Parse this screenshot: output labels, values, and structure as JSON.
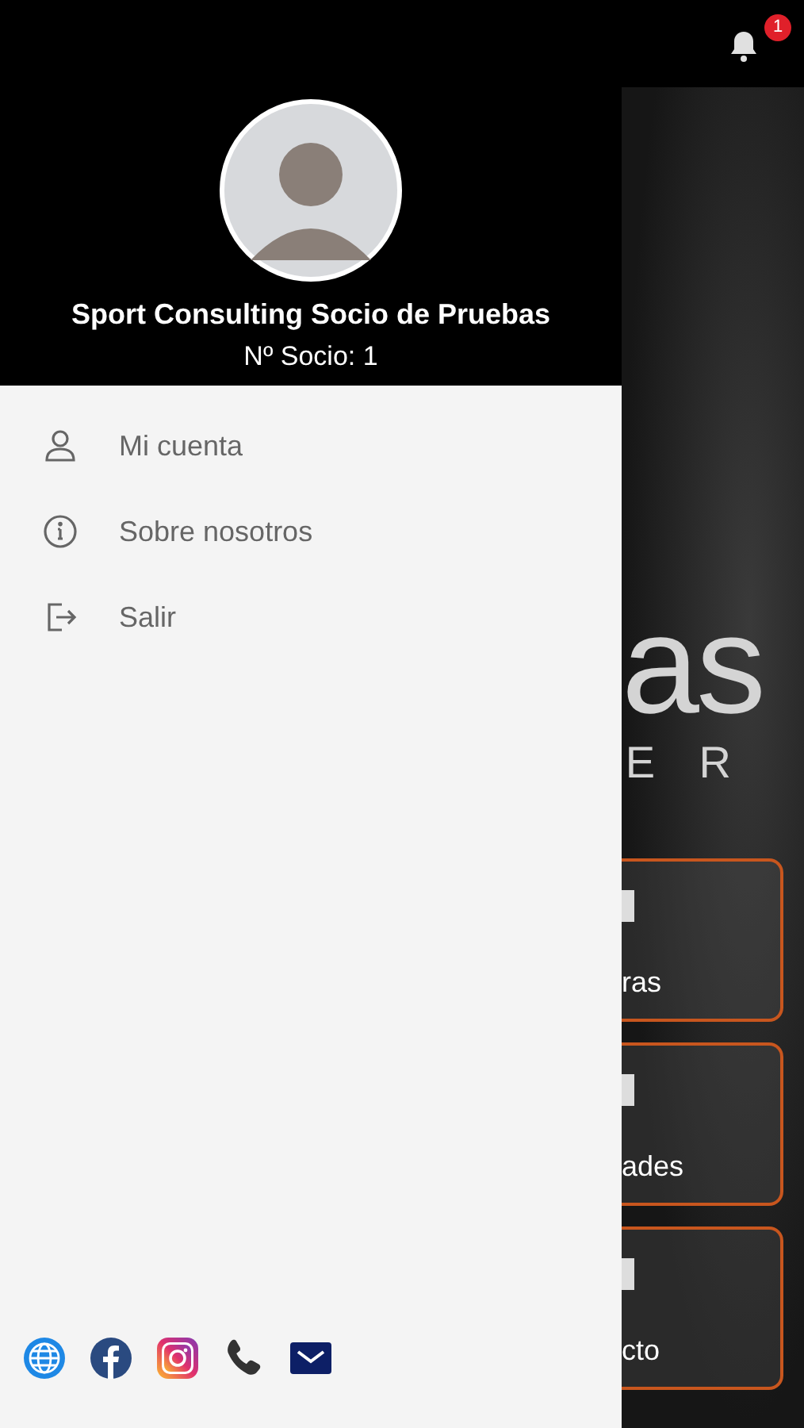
{
  "notifications": {
    "count": "1"
  },
  "profile": {
    "name": "Sport Consulting Socio de Pruebas",
    "member_number": "Nº Socio: 1"
  },
  "menu": [
    {
      "kind": "user",
      "label": "Mi cuenta"
    },
    {
      "kind": "info",
      "label": "Sobre nosotros"
    },
    {
      "kind": "logout",
      "label": "Salir"
    }
  ],
  "social": [
    {
      "kind": "web"
    },
    {
      "kind": "facebook"
    },
    {
      "kind": "instagram"
    },
    {
      "kind": "phone"
    },
    {
      "kind": "mail"
    }
  ],
  "background": {
    "logo_fragment": "as",
    "logo_subtitle_fragment": "E R",
    "cards": [
      {
        "label": "ras"
      },
      {
        "label": "ades"
      },
      {
        "label": "cto"
      }
    ]
  }
}
